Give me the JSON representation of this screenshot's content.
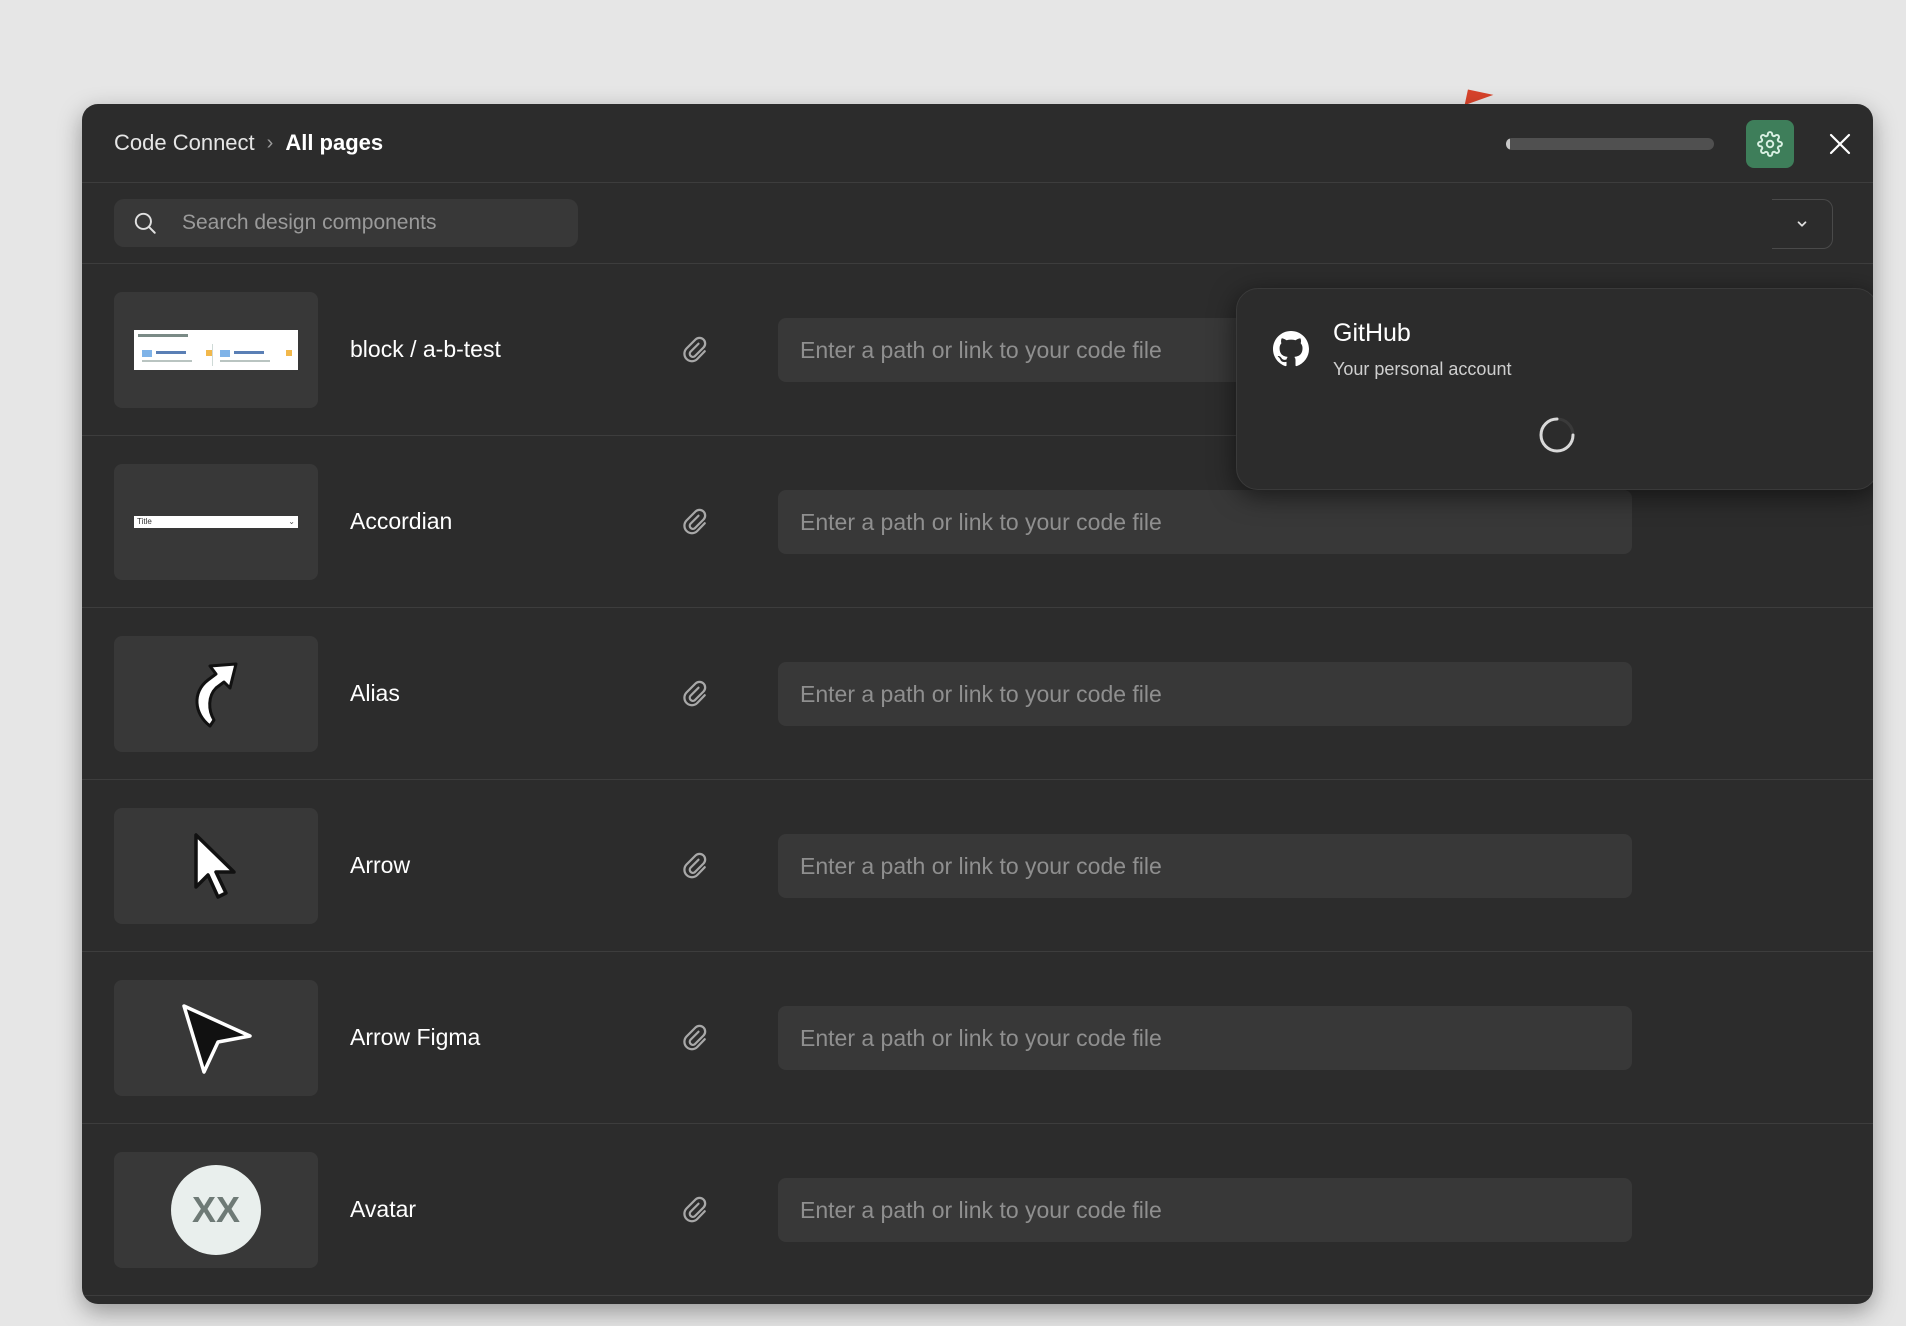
{
  "header": {
    "breadcrumb_root": "Code Connect",
    "breadcrumb_separator": "›",
    "breadcrumb_current": "All pages",
    "progress_fraction": 0.02,
    "settings_icon": "gear-icon",
    "close_icon": "close-icon"
  },
  "search": {
    "placeholder": "Search design components",
    "value": ""
  },
  "popover": {
    "title": "GitHub",
    "subtitle": "Your personal account",
    "icon": "github-icon",
    "loading": true
  },
  "components": [
    {
      "name": "block / a-b-test",
      "thumb": "ab-test-preview",
      "placeholder": "Enter a path or link to your code file",
      "value": ""
    },
    {
      "name": "Accordian",
      "thumb": "accordion-preview",
      "thumb_text": "Title",
      "placeholder": "Enter a path or link to your code file",
      "value": ""
    },
    {
      "name": "Alias",
      "thumb": "alias-arrow-icon",
      "placeholder": "Enter a path or link to your code file",
      "value": ""
    },
    {
      "name": "Arrow",
      "thumb": "cursor-arrow-icon",
      "placeholder": "Enter a path or link to your code file",
      "value": ""
    },
    {
      "name": "Arrow Figma",
      "thumb": "figma-arrow-icon",
      "placeholder": "Enter a path or link to your code file",
      "value": ""
    },
    {
      "name": "Avatar",
      "thumb": "avatar-preview",
      "thumb_text": "XX",
      "placeholder": "Enter a path or link to your code file",
      "value": ""
    }
  ],
  "colors": {
    "modal_bg": "#2c2c2c",
    "input_bg": "#383838",
    "accent_green": "#3e7e5a",
    "page_bg": "#e6e6e6"
  }
}
